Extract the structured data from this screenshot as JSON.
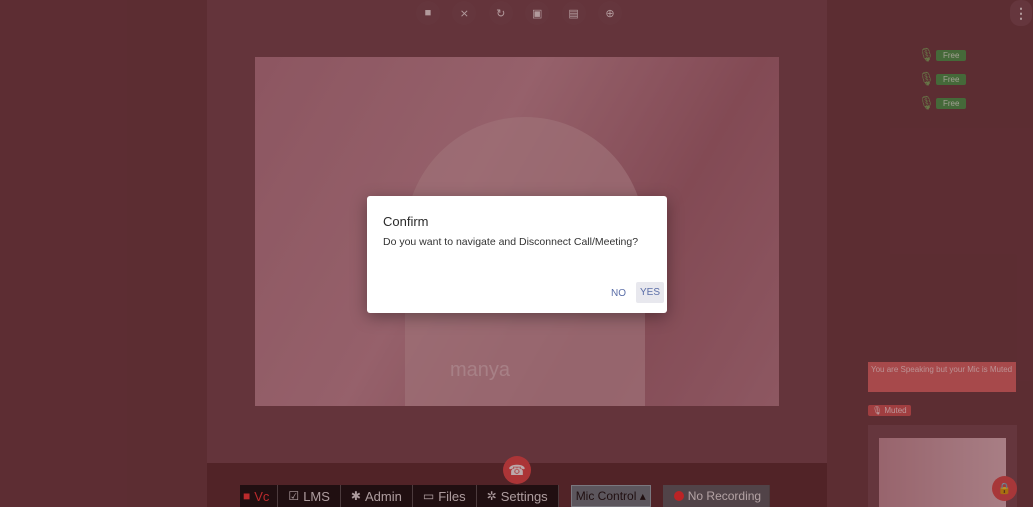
{
  "top_toolbar": {
    "icons": [
      "video-camera-icon",
      "mic-off-icon",
      "refresh-icon",
      "screen-share-icon",
      "chat-icon",
      "crosshair-icon"
    ]
  },
  "menu_icon": "⋮",
  "video": {
    "watermark": "manya"
  },
  "participants": [
    {
      "status": "Free"
    },
    {
      "status": "Free"
    },
    {
      "status": "Free"
    }
  ],
  "speaking_alert": "You are Speaking but your Mic is Muted",
  "muted_badge": "🎙 Muted",
  "bottom_bar": {
    "vc": "Vc",
    "lms": "LMS",
    "admin": "Admin",
    "files": "Files",
    "settings": "Settings",
    "mic_control": "Mic Control ▴",
    "recording": "No Recording"
  },
  "dialog": {
    "title": "Confirm",
    "message": "Do you want to navigate and Disconnect Call/Meeting?",
    "no_label": "NO",
    "yes_label": "YES"
  },
  "colors": {
    "end_call": "#e74c4c",
    "status_free": "#4b9b4f",
    "alert": "#e06a6a"
  }
}
